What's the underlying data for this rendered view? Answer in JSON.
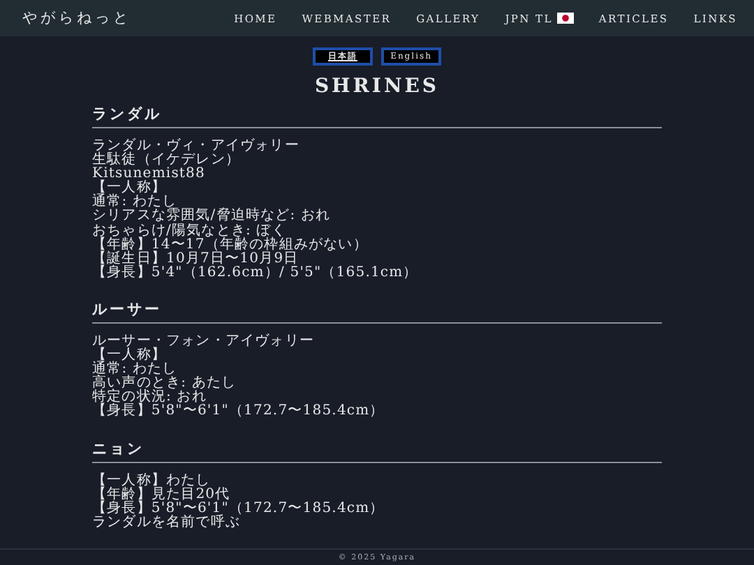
{
  "header": {
    "site_title": "やがらねっと",
    "nav": [
      {
        "label": "HOME",
        "flag": false
      },
      {
        "label": "WEBMASTER",
        "flag": false
      },
      {
        "label": "GALLERY",
        "flag": false
      },
      {
        "label": "JPN TL",
        "flag": true
      },
      {
        "label": "ARTICLES",
        "flag": false
      },
      {
        "label": "LINKS",
        "flag": false
      }
    ]
  },
  "language_buttons": [
    {
      "label": "日本語",
      "selected": true
    },
    {
      "label": "English",
      "selected": false
    }
  ],
  "page_title": "SHRINES",
  "sections": [
    {
      "heading": "ランダル",
      "lines": [
        "ランダル・ヴィ・アイヴォリー",
        "生駄徒（イケデレン）",
        "Kitsunemist88",
        "【一人称】",
        "通常: わたし",
        "シリアスな雰囲気/脅迫時など: おれ",
        "おちゃらけ/陽気なとき: ぼく",
        "【年齢】14〜17（年齢の枠組みがない）",
        "【誕生日】10月7日〜10月9日",
        "【身長】5'4\"（162.6cm）/ 5'5\"（165.1cm）"
      ]
    },
    {
      "heading": "ルーサー",
      "lines": [
        "ルーサー・フォン・アイヴォリー",
        "【一人称】",
        "通常: わたし",
        "高い声のとき: あたし",
        "特定の状況: おれ",
        "【身長】5'8\"〜6'1\"（172.7〜185.4cm）"
      ]
    },
    {
      "heading": "ニョン",
      "lines": [
        "【一人称】わたし",
        "【年齢】見た目20代",
        "【身長】5'8\"〜6'1\"（172.7〜185.4cm）",
        "ランダルを名前で呼ぶ"
      ]
    }
  ],
  "footer": "© 2025 Yagara"
}
